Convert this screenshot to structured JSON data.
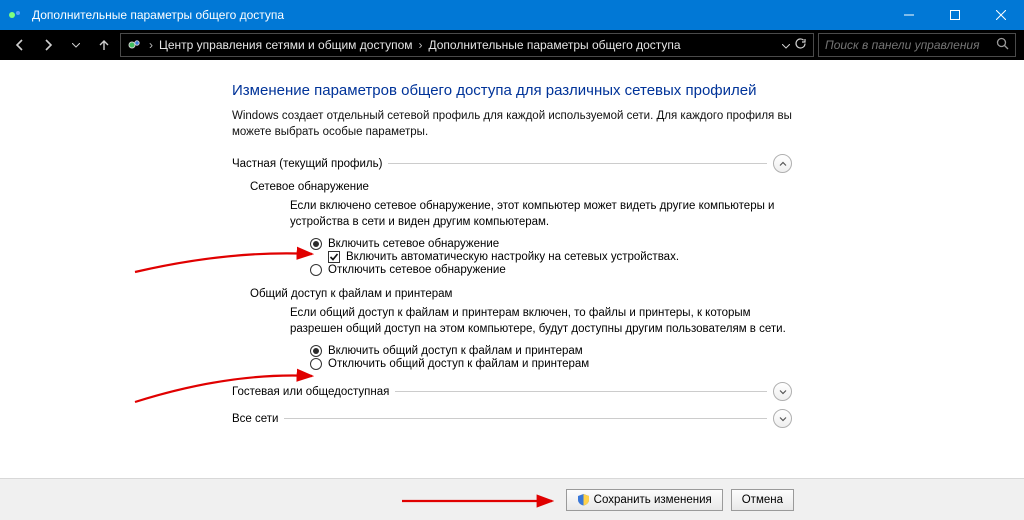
{
  "titlebar": {
    "title": "Дополнительные параметры общего доступа"
  },
  "breadcrumb": {
    "item1": "Центр управления сетями и общим доступом",
    "item2": "Дополнительные параметры общего доступа"
  },
  "search": {
    "placeholder": "Поиск в панели управления"
  },
  "heading": "Изменение параметров общего доступа для различных сетевых профилей",
  "intro": "Windows создает отдельный сетевой профиль для каждой используемой сети. Для каждого профиля вы можете выбрать особые параметры.",
  "profile_private": {
    "title": "Частная (текущий профиль)",
    "discovery": {
      "heading": "Сетевое обнаружение",
      "desc": "Если включено сетевое обнаружение, этот компьютер может видеть другие компьютеры и устройства в сети и виден другим компьютерам.",
      "opt_on": "Включить сетевое обнаружение",
      "opt_auto": "Включить автоматическую настройку на сетевых устройствах.",
      "opt_off": "Отключить сетевое обнаружение"
    },
    "file_sharing": {
      "heading": "Общий доступ к файлам и принтерам",
      "desc": "Если общий доступ к файлам и принтерам включен, то файлы и принтеры, к которым разрешен общий доступ на этом компьютере, будут доступны другим пользователям в сети.",
      "opt_on": "Включить общий доступ к файлам и принтерам",
      "opt_off": "Отключить общий доступ к файлам и принтерам"
    }
  },
  "profile_guest": {
    "title": "Гостевая или общедоступная"
  },
  "profile_all": {
    "title": "Все сети"
  },
  "buttons": {
    "save": "Сохранить изменения",
    "cancel": "Отмена"
  }
}
